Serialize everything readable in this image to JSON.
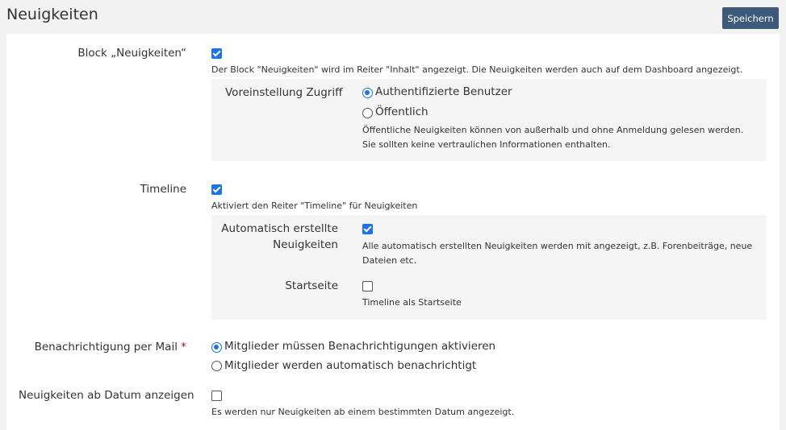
{
  "header": {
    "title": "Neuigkeiten",
    "save_label": "Speichern"
  },
  "block": {
    "label": "Block „Neuigkeiten“",
    "checked": true,
    "help": "Der Block \"Neuigkeiten\" wird im Reiter \"Inhalt\" angezeigt. Die Neuigkeiten werden auch auf dem Dashboard angezeigt.",
    "access": {
      "label": "Voreinstellung Zugriff",
      "options": [
        "Authentifizierte Benutzer",
        "Öffentlich"
      ],
      "selected": "Authentifizierte Benutzer",
      "help_line1": "Öffentliche Neuigkeiten können von außerhalb und ohne Anmeldung gelesen werden.",
      "help_line2": "Sie sollten keine vertraulichen Informationen enthalten."
    }
  },
  "timeline": {
    "label": "Timeline",
    "checked": true,
    "help": "Aktiviert den Reiter \"Timeline\" für Neuigkeiten",
    "auto": {
      "label_line1": "Automatisch erstellte",
      "label_line2": "Neuigkeiten",
      "checked": true,
      "help_line1": "Alle automatisch erstellten Neuigkeiten werden mit angezeigt, z.B. Forenbeiträge, neue",
      "help_line2": "Dateien etc."
    },
    "start": {
      "label": "Startseite",
      "checked": false,
      "help": "Timeline als Startseite"
    }
  },
  "mail": {
    "label": "Benachrichtigung per Mail",
    "required_marker": "*",
    "options": [
      "Mitglieder müssen Benachrichtigungen aktivieren",
      "Mitglieder werden automatisch benachrichtigt"
    ],
    "selected": "Mitglieder müssen Benachrichtigungen aktivieren"
  },
  "date": {
    "label": "Neuigkeiten ab Datum anzeigen",
    "checked": false,
    "help": "Es werden nur Neuigkeiten ab einem bestimmten Datum angezeigt."
  },
  "colors": {
    "accent": "#1a73e8",
    "save_button": "#3d5a7a",
    "required": "#d0021b"
  }
}
